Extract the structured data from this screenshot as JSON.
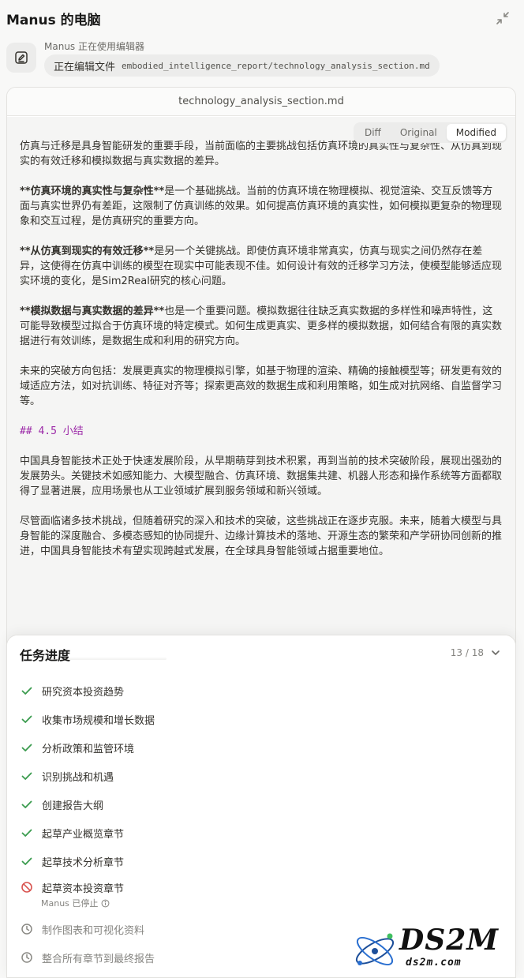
{
  "header": {
    "title": "Manus 的电脑"
  },
  "status": {
    "text": "Manus 正在使用编辑器",
    "verb": "正在编辑文件",
    "path": "embodied_intelligence_report/technology_analysis_section.md"
  },
  "editor": {
    "filename": "technology_analysis_section.md",
    "tabs": [
      {
        "label": "Diff"
      },
      {
        "label": "Original"
      },
      {
        "label": "Modified",
        "active": true
      }
    ],
    "paragraphs": {
      "p1": "仿真与迁移是具身智能研发的重要手段，当前面临的主要挑战包括仿真环境的真实性与复杂性、从仿真到现实的有效迁移和模拟数据与真实数据的差异。",
      "p2_bold": "**仿真环境的真实性与复杂性**",
      "p2_rest": "是一个基础挑战。当前的仿真环境在物理模拟、视觉渲染、交互反馈等方面与真实世界仍有差距，这限制了仿真训练的效果。如何提高仿真环境的真实性，如何模拟更复杂的物理现象和交互过程，是仿真研究的重要方向。",
      "p3_bold": "**从仿真到现实的有效迁移**",
      "p3_rest": "是另一个关键挑战。即使仿真环境非常真实，仿真与现实之间仍然存在差异，这使得在仿真中训练的模型在现实中可能表现不佳。如何设计有效的迁移学习方法，使模型能够适应现实环境的变化，是Sim2Real研究的核心问题。",
      "p4_bold": "**模拟数据与真实数据的差异**",
      "p4_rest": "也是一个重要问题。模拟数据往往缺乏真实数据的多样性和噪声特性，这可能导致模型过拟合于仿真环境的特定模式。如何生成更真实、更多样的模拟数据，如何结合有限的真实数据进行有效训练，是数据生成和利用的研究方向。",
      "p5": "未来的突破方向包括：发展更真实的物理模拟引擎，如基于物理的渲染、精确的接触模型等；研发更有效的域适应方法，如对抗训练、特征对齐等；探索更高效的数据生成和利用策略，如生成对抗网络、自监督学习等。",
      "h45": "## 4.5 小结",
      "p6": "中国具身智能技术正处于快速发展阶段，从早期萌芽到技术积累，再到当前的技术突破阶段，展现出强劲的发展势头。关键技术如感知能力、大模型融合、仿真环境、数据集共建、机器人形态和操作系统等方面都取得了显著进展，应用场景也从工业领域扩展到服务领域和新兴领域。",
      "p7": "尽管面临诸多技术挑战，但随着研究的深入和技术的突破，这些挑战正在逐步克服。未来，随着大模型与具身智能的深度融合、多模态感知的协同提升、边缘计算技术的落地、开源生态的繁荣和产学研协同创新的推进，中国具身智能技术有望实现跨越式发展，在全球具身智能领域占据重要地位。"
    }
  },
  "progress": {
    "title": "任务进度",
    "count": "13 / 18",
    "tasks": [
      {
        "label": "研究资本投资趋势",
        "status": "done"
      },
      {
        "label": "收集市场规模和增长数据",
        "status": "done"
      },
      {
        "label": "分析政策和监管环境",
        "status": "done"
      },
      {
        "label": "识别挑战和机遇",
        "status": "done"
      },
      {
        "label": "创建报告大纲",
        "status": "done"
      },
      {
        "label": "起草产业概览章节",
        "status": "done"
      },
      {
        "label": "起草技术分析章节",
        "status": "done"
      },
      {
        "label": "起草资本投资章节",
        "status": "stopped",
        "note": "Manus 已停止"
      },
      {
        "label": "制作图表和可视化资料",
        "status": "pending"
      },
      {
        "label": "整合所有章节到最终报告",
        "status": "pending"
      }
    ]
  },
  "watermark": {
    "brand": "DS2M",
    "site": "ds2m.com"
  },
  "colors": {
    "check": "#3a9b4e",
    "stopped": "#d9534f",
    "heading": "#9c2aa8"
  }
}
